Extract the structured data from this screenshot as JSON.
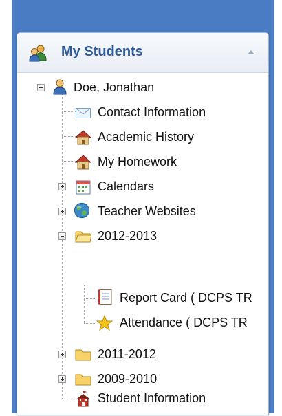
{
  "panel": {
    "title": "My Students"
  },
  "tree": {
    "student": "Doe, Jonathan",
    "items": {
      "contact": "Contact Information",
      "academic_history": "Academic History",
      "homework": "My Homework",
      "calendars": "Calendars",
      "teacher_websites": "Teacher Websites",
      "year_2012": "2012-2013",
      "report_card": "Report Card ( DCPS TR",
      "attendance": "Attendance ( DCPS TR",
      "year_2011": "2011-2012",
      "year_2009": "2009-2010",
      "student_info": "Student Information"
    }
  },
  "colors": {
    "outer_frame": "#4a7cc4",
    "title_text": "#2e5a95",
    "panel_border": "#9fb5d6"
  },
  "icons": {
    "header": "students-icon",
    "student": "student-person-icon",
    "contact": "envelope-icon",
    "academic_history": "house-icon",
    "homework": "house-icon",
    "calendars": "calendar-icon",
    "teacher_websites": "globe-icon",
    "year_folders": "folder-icon",
    "report_card": "notebook-icon",
    "attendance": "star-icon",
    "student_info": "schoolhouse-icon"
  }
}
